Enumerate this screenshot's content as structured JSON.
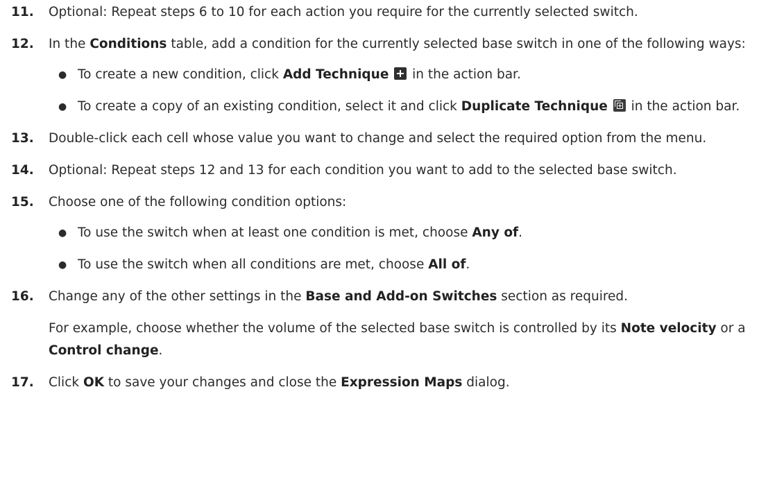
{
  "steps": [
    {
      "num": "11.",
      "prefix": "Optional: Repeat steps 6 to 10 for each action you require for the currently selected switch."
    },
    {
      "num": "12.",
      "a": "In the ",
      "b": "Conditions",
      "c": " table, add a condition for the currently selected base switch in one of the following ways:",
      "bullets": [
        {
          "a": "To create a new condition, click ",
          "b": "Add Technique",
          "c": " in the action bar.",
          "icon": "add-technique-icon"
        },
        {
          "a": "To create a copy of an existing condition, select it and click ",
          "b": "Duplicate Technique",
          "c": " in the action bar.",
          "icon": "duplicate-technique-icon"
        }
      ]
    },
    {
      "num": "13.",
      "text": "Double-click each cell whose value you want to change and select the required option from the menu."
    },
    {
      "num": "14.",
      "text": "Optional: Repeat steps 12 and 13 for each condition you want to add to the selected base switch."
    },
    {
      "num": "15.",
      "text": "Choose one of the following condition options:",
      "bullets": [
        {
          "a": "To use the switch when at least one condition is met, choose ",
          "b": "Any of",
          "c": "."
        },
        {
          "a": "To use the switch when all conditions are met, choose ",
          "b": "All of",
          "c": "."
        }
      ]
    },
    {
      "num": "16.",
      "a": "Change any of the other settings in the ",
      "b": "Base and Add-on Switches",
      "c": " section as required.",
      "p2a": "For example, choose whether the volume of the selected base switch is controlled by its ",
      "p2b": "Note velocity",
      "p2c": " or a ",
      "p2d": "Control change",
      "p2e": "."
    },
    {
      "num": "17.",
      "a": "Click ",
      "b": "OK",
      "c": " to save your changes and close the ",
      "d": "Expression Maps",
      "e": " dialog."
    }
  ]
}
